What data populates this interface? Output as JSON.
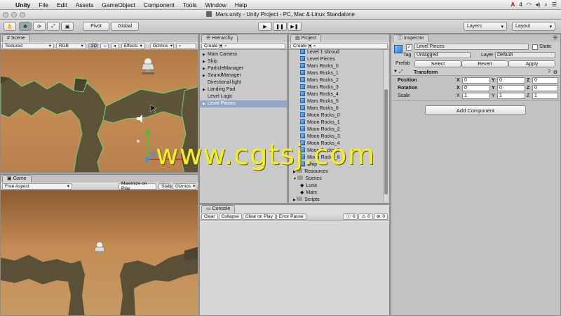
{
  "menubar": {
    "app": "Unity",
    "items": [
      "File",
      "Edit",
      "Assets",
      "GameObject",
      "Component",
      "Tools",
      "Window",
      "Help"
    ],
    "battery_label": "4"
  },
  "window_title": "Mars.unity - Unity Project - PC, Mac & Linux Standalone",
  "toolbar": {
    "pivot": "Pivot",
    "global": "Global",
    "layers": "Layers",
    "layout": "Layout"
  },
  "scene": {
    "tab": "Scene",
    "textured": "Textured",
    "rgb": "RGB",
    "mode2d": "2D",
    "effects": "Effects",
    "gizmos": "Gizmos"
  },
  "game": {
    "tab": "Game",
    "aspect": "Free Aspect",
    "maximize": "Maximize on Play",
    "stats": "Stats",
    "gizmos": "Gizmos"
  },
  "hierarchy": {
    "tab": "Hierarchy",
    "create": "Create",
    "items": [
      {
        "label": "Main Camera",
        "arrow": "▶"
      },
      {
        "label": "Ship",
        "arrow": "▶"
      },
      {
        "label": "ParticleManager",
        "arrow": "▶"
      },
      {
        "label": "SoundManager",
        "arrow": "▶"
      },
      {
        "label": "Directional light",
        "arrow": ""
      },
      {
        "label": "Landing Pad",
        "arrow": "▶"
      },
      {
        "label": "Level Logic",
        "arrow": ""
      },
      {
        "label": "Level Pieces",
        "arrow": "▶",
        "selected": true
      }
    ]
  },
  "project": {
    "tab": "Project",
    "create": "Create",
    "items": [
      {
        "label": "Level 1 shroud",
        "icon": "cube",
        "indent": 1
      },
      {
        "label": "Level Pieces",
        "icon": "cube",
        "indent": 1
      },
      {
        "label": "Mars Rocks_0",
        "icon": "cube",
        "indent": 1
      },
      {
        "label": "Mars Rocks_1",
        "icon": "cube",
        "indent": 1
      },
      {
        "label": "Mars Rocks_2",
        "icon": "cube",
        "indent": 1
      },
      {
        "label": "Mars Rocks_3",
        "icon": "cube",
        "indent": 1
      },
      {
        "label": "Mars Rocks_4",
        "icon": "cube",
        "indent": 1
      },
      {
        "label": "Mars Rocks_5",
        "icon": "cube",
        "indent": 1
      },
      {
        "label": "Mars Rocks_6",
        "icon": "cube",
        "indent": 1
      },
      {
        "label": "Moon Rocks_0",
        "icon": "cube",
        "indent": 1
      },
      {
        "label": "Moon Rocks_1",
        "icon": "cube",
        "indent": 1
      },
      {
        "label": "Moon Rocks_2",
        "icon": "cube",
        "indent": 1
      },
      {
        "label": "Moon Rocks_3",
        "icon": "cube",
        "indent": 1
      },
      {
        "label": "Moon Rocks_4",
        "icon": "cube",
        "indent": 1
      },
      {
        "label": "Moon Rocks_5",
        "icon": "cube",
        "indent": 1
      },
      {
        "label": "Moon Rocks_6",
        "icon": "cube",
        "indent": 1
      },
      {
        "label": "Ship",
        "icon": "cube",
        "indent": 1
      },
      {
        "label": "Resources",
        "icon": "folder",
        "indent": 0
      },
      {
        "label": "Scenes",
        "icon": "folder",
        "indent": 0
      },
      {
        "label": "Luna",
        "icon": "unity",
        "indent": 1
      },
      {
        "label": "Mars",
        "icon": "unity",
        "indent": 1
      },
      {
        "label": "Scripts",
        "icon": "folder",
        "indent": 0
      }
    ]
  },
  "console": {
    "tab": "Console",
    "clear": "Clear",
    "collapse": "Collapse",
    "clear_on_play": "Clear on Play",
    "error_pause": "Error Pause",
    "count_info": "0",
    "count_warn": "0",
    "count_error": "0"
  },
  "inspector": {
    "tab": "Inspector",
    "object_name": "Level Pieces",
    "static": "Static",
    "tag_label": "Tag",
    "tag_value": "Untagged",
    "layer_label": "Layer",
    "layer_value": "Default",
    "prefab_label": "Prefab",
    "prefab_select": "Select",
    "prefab_revert": "Revert",
    "prefab_apply": "Apply",
    "transform_label": "Transform",
    "position_label": "Position",
    "rotation_label": "Rotation",
    "scale_label": "Scale",
    "x": "X",
    "y": "Y",
    "z": "Z",
    "position": [
      "0",
      "0",
      "0"
    ],
    "rotation": [
      "0",
      "0",
      "0"
    ],
    "scale": [
      "1",
      "1",
      "1"
    ],
    "add_component": "Add Component"
  },
  "watermark": "www.cgtsj.com"
}
